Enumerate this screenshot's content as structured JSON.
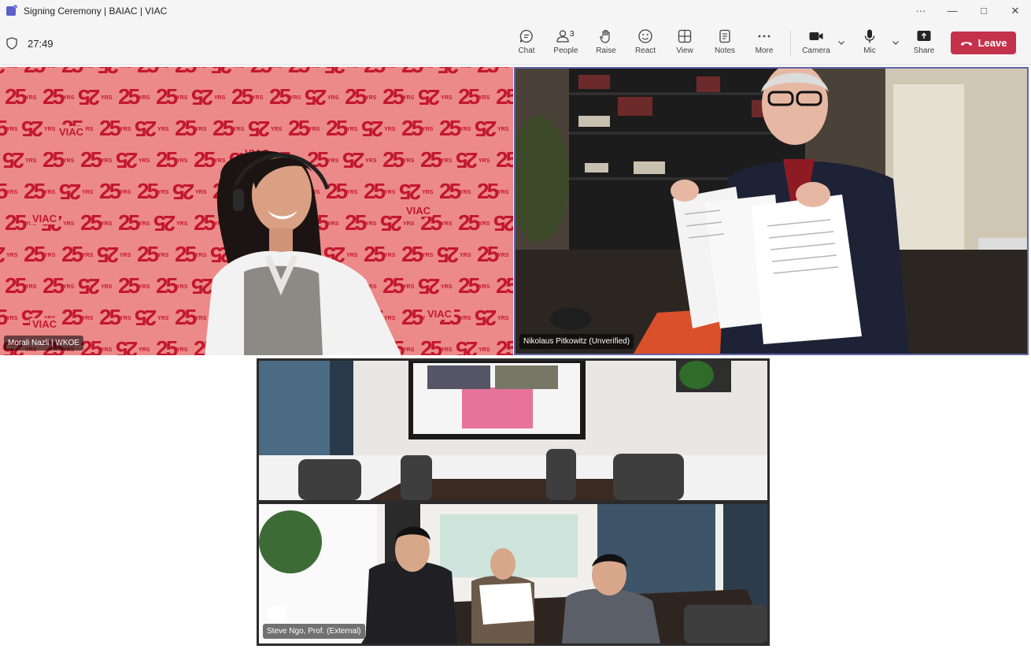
{
  "window": {
    "title": "Signing Ceremony | BAIAC | VIAC",
    "controls": [
      "···",
      "—",
      "□",
      "✕"
    ]
  },
  "toolbar": {
    "timer": "27:49",
    "chat": "Chat",
    "people": "People",
    "people_count": "3",
    "raise": "Raise",
    "react": "React",
    "view": "View",
    "notes": "Notes",
    "more": "More",
    "camera": "Camera",
    "mic": "Mic",
    "share": "Share",
    "leave": "Leave"
  },
  "participants": [
    {
      "name": "Morali Nazli | WKOE"
    },
    {
      "name": "Nikolaus Pitkowitz (Unverified)"
    },
    {
      "name": "Steve Ngo, Prof. (External)"
    }
  ],
  "background_text": {
    "viac": "VIAC",
    "mark": "25",
    "yrs": "YRS"
  },
  "colors": {
    "leave": "#c4314b",
    "active_speaker_outline": "#6264a7",
    "viac_red": "#c2182b",
    "viac_pink": "#ec8a8a"
  }
}
